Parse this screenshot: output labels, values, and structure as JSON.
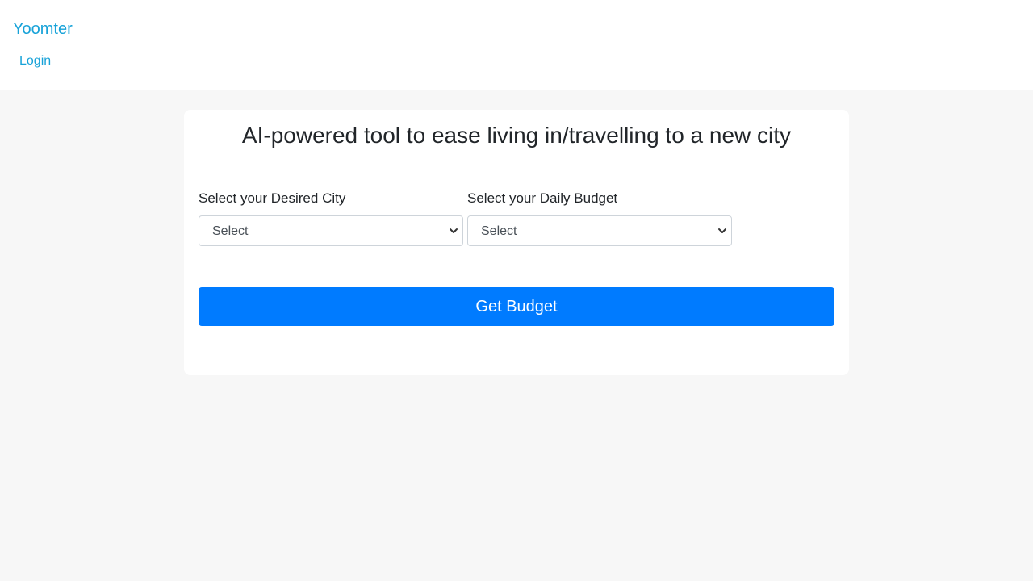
{
  "header": {
    "brand": "Yoomter",
    "login_label": "Login"
  },
  "main": {
    "title": "AI-powered tool to ease living in/travelling to a new city",
    "city_field": {
      "label": "Select your Desired City",
      "selected": "Select"
    },
    "budget_field": {
      "label": "Select your Daily Budget",
      "selected": "Select"
    },
    "submit_label": "Get Budget"
  },
  "icons": {
    "dropdown": "chevron-down-icon"
  },
  "colors": {
    "page_background": "#f7f7f7",
    "header_background": "#ffffff",
    "card_background": "#ffffff",
    "link": "#17a2d8",
    "primary_button": "#007bff",
    "button_text": "#ffffff",
    "text": "#212529",
    "select_border": "#ced4da"
  }
}
